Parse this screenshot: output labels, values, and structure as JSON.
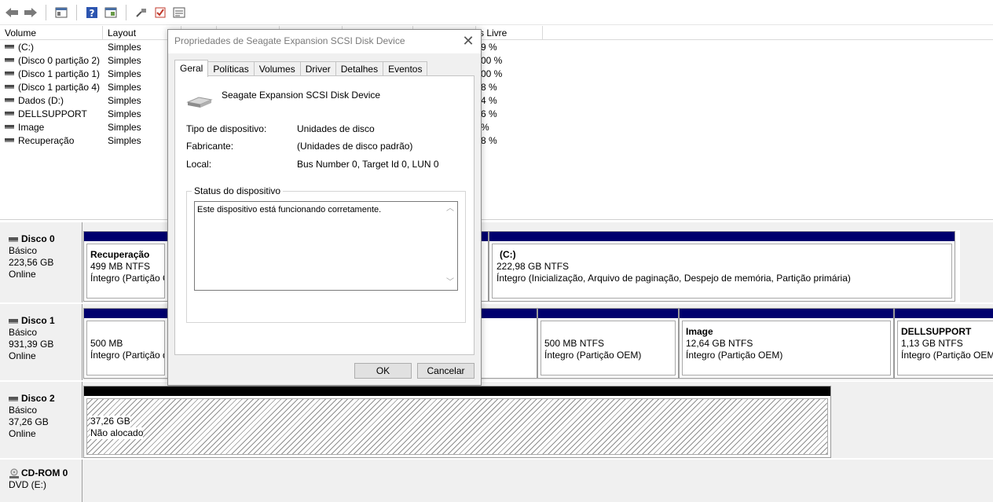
{
  "toolbar": {
    "icons": [
      "back-arrow-icon",
      "forward-arrow-icon",
      "console-tree-icon",
      "help-icon",
      "properties-pane-icon",
      "connect-icon",
      "check-icon",
      "settings-list-icon"
    ]
  },
  "volume_list": {
    "columns": [
      "Volume",
      "Layout",
      "s Livre"
    ],
    "rows": [
      {
        "volume": "(C:)",
        "layout": "Simples",
        "free": "9 %"
      },
      {
        "volume": "(Disco 0 partição 2)",
        "layout": "Simples",
        "free": "00 %"
      },
      {
        "volume": "(Disco 1 partição 1)",
        "layout": "Simples",
        "free": "00 %"
      },
      {
        "volume": "(Disco 1 partição 4)",
        "layout": "Simples",
        "free": "8 %"
      },
      {
        "volume": "Dados (D:)",
        "layout": "Simples",
        "free": "4 %"
      },
      {
        "volume": "DELLSUPPORT",
        "layout": "Simples",
        "free": "6 %"
      },
      {
        "volume": "Image",
        "layout": "Simples",
        "free": " %"
      },
      {
        "volume": "Recuperação",
        "layout": "Simples",
        "free": "8 %"
      }
    ]
  },
  "disks": [
    {
      "name": "Disco 0",
      "type": "Básico",
      "size": "223,56 GB",
      "status": "Online"
    },
    {
      "name": "Disco 1",
      "type": "Básico",
      "size": "931,39 GB",
      "status": "Online"
    },
    {
      "name": "Disco 2",
      "type": "Básico",
      "size": "37,26 GB",
      "status": "Online"
    },
    {
      "name": "CD-ROM 0",
      "type": "DVD (E:)"
    }
  ],
  "partitions": {
    "d0_recuperacao": {
      "title": "Recuperação",
      "size": "499 MB NTFS",
      "state": "Íntegro (Partição O"
    },
    "d0_c": {
      "title": "(C:)",
      "size": "222,98 GB NTFS",
      "state": "Íntegro (Inicialização, Arquivo de paginação, Despejo de memória, Partição primária)"
    },
    "d1_p1": {
      "size": "500 MB",
      "state": "Íntegro (Partição de"
    },
    "d1_p3": {
      "size": "500 MB NTFS",
      "state": "Íntegro (Partição OEM)"
    },
    "d1_image": {
      "title": "Image",
      "size": "12,64 GB NTFS",
      "state": "Íntegro (Partição OEM)"
    },
    "d1_dell": {
      "title": "DELLSUPPORT",
      "size": "1,13 GB NTFS",
      "state": "Íntegro (Partição OEM)"
    },
    "d2_unalloc": {
      "size": "37,26 GB",
      "state": "Não alocado"
    }
  },
  "dialog": {
    "title": "Propriedades de Seagate Expansion SCSI Disk Device",
    "tabs": [
      "Geral",
      "Políticas",
      "Volumes",
      "Driver",
      "Detalhes",
      "Eventos"
    ],
    "device_name": "Seagate Expansion SCSI Disk Device",
    "props": [
      {
        "label": "Tipo de dispositivo:",
        "value": "Unidades de disco"
      },
      {
        "label": "Fabricante:",
        "value": "(Unidades de disco padrão)"
      },
      {
        "label": "Local:",
        "value": "Bus Number 0, Target Id 0, LUN 0"
      }
    ],
    "status_group_label": "Status do dispositivo",
    "status_text": "Este dispositivo está funcionando corretamente.",
    "ok_label": "OK",
    "cancel_label": "Cancelar"
  },
  "colors": {
    "partition_bar": "#00006e",
    "unallocated_bar": "#000000"
  }
}
